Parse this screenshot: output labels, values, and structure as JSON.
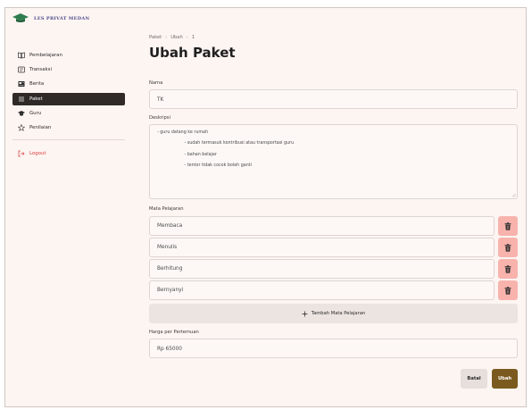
{
  "brand": {
    "name": "LES PRIVAT MEDAN"
  },
  "sidebar": {
    "items": [
      {
        "label": "Pembelajaran",
        "icon": "book-icon"
      },
      {
        "label": "Transaksi",
        "icon": "receipt-icon"
      },
      {
        "label": "Berita",
        "icon": "newspaper-icon"
      },
      {
        "label": "Paket",
        "icon": "list-icon",
        "active": true
      },
      {
        "label": "Guru",
        "icon": "graduation-cap-icon"
      },
      {
        "label": "Penilaian",
        "icon": "star-icon"
      }
    ],
    "logout": {
      "label": "Logout",
      "icon": "logout-icon"
    }
  },
  "breadcrumb": [
    "Paket",
    "Ubah",
    "1"
  ],
  "page": {
    "title": "Ubah Paket"
  },
  "form": {
    "nama": {
      "label": "Nama",
      "value": "TK"
    },
    "deskripsi": {
      "label": "Deskripsi",
      "lines": [
        "- guru datang ke rumah",
        "                    - sudah termasuk kontribusi atau transportasi guru",
        "                    - bahan belajar",
        "                    - tentor tidak cocok boleh ganti"
      ]
    },
    "mata_pelajaran": {
      "label": "Mata Pelajaran",
      "items": [
        "Membaca",
        "Menulis",
        "Berhitung",
        "Bernyanyi"
      ],
      "add_label": "Tambah Mata Pelajaran"
    },
    "harga": {
      "label": "Harga per Pertemuan",
      "value": "Rp  65000"
    }
  },
  "actions": {
    "cancel": "Batal",
    "save": "Ubah"
  },
  "colors": {
    "background": "#fdf5f2",
    "active_nav": "#2f2a27",
    "delete": "#f8b3ad",
    "save": "#7a5a1e",
    "logout": "#d93a3a"
  }
}
